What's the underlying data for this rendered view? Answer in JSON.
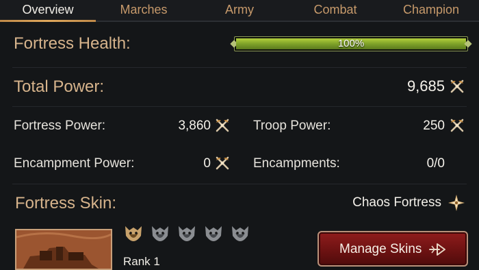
{
  "tabs": [
    {
      "label": "Overview",
      "active": true
    },
    {
      "label": "Marches",
      "active": false
    },
    {
      "label": "Army",
      "active": false
    },
    {
      "label": "Combat",
      "active": false
    },
    {
      "label": "Champion",
      "active": false
    }
  ],
  "fortress_health": {
    "label": "Fortress Health:",
    "value_text": "100%",
    "percent": 100
  },
  "total_power": {
    "label": "Total Power:",
    "value": "9,685"
  },
  "stats": {
    "fortress_power": {
      "label": "Fortress Power:",
      "value": "3,860"
    },
    "troop_power": {
      "label": "Troop Power:",
      "value": "250"
    },
    "encampment_power": {
      "label": "Encampment Power:",
      "value": "0"
    },
    "encampments": {
      "label": "Encampments:",
      "value": "0/0"
    }
  },
  "fortress_skin": {
    "label": "Fortress Skin:",
    "name": "Chaos Fortress",
    "rank_text": "Rank 1",
    "rank_level": 1,
    "rank_max": 5
  },
  "manage_button": {
    "label": "Manage Skins"
  },
  "icons": {
    "power": "crossed-axes-icon",
    "skin": "star-emblem-icon",
    "rank": "demon-badge-icon",
    "arrow": "arrow-right-icon"
  },
  "colors": {
    "accent_gold": "#d7b48c",
    "tab_inactive": "#c79a6b",
    "health_green": "#8fb531",
    "button_red": "#7a1515"
  }
}
